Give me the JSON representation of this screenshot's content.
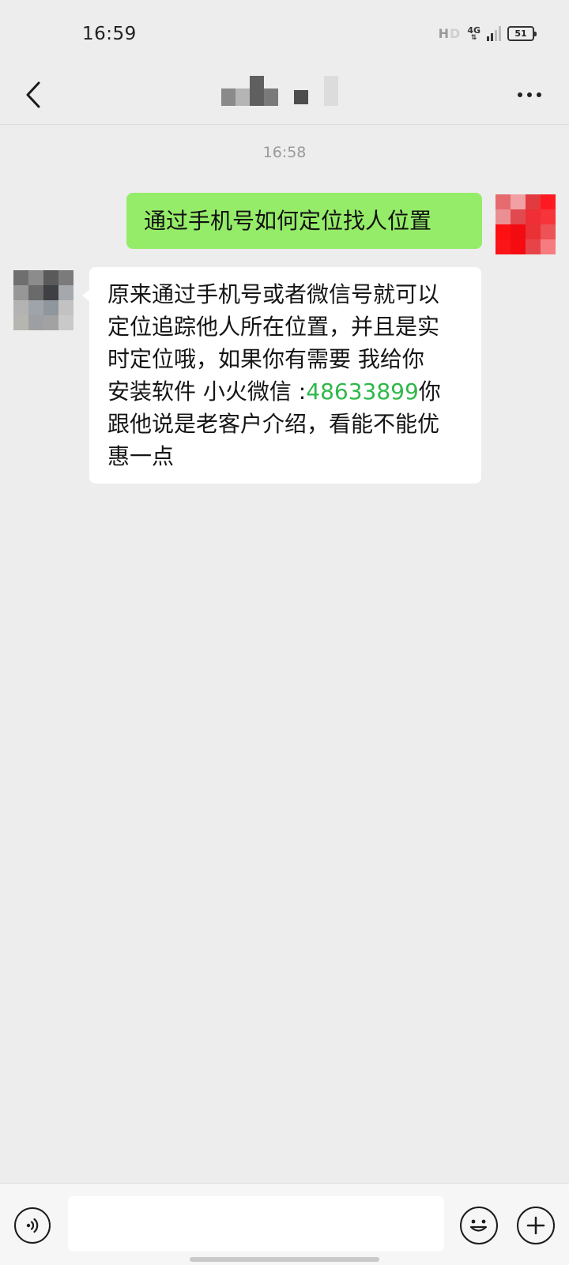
{
  "status_bar": {
    "time": "16:59",
    "hd_label": "HD",
    "network_label": "4G",
    "battery_level": "51"
  },
  "header": {
    "back_icon": "chevron-left-icon",
    "title_obscured": true,
    "more_icon": "more-dots-icon"
  },
  "chat": {
    "timestamp": "16:58",
    "messages": [
      {
        "sender": "self",
        "lines": [
          "通过手机号如何定位找人位置"
        ]
      },
      {
        "sender": "other",
        "lines": [
          "原来通过手机号或者微信号就可以",
          "定位追踪他人所在位置，并且是实",
          "时定位哦，如果你有需要 我给你"
        ],
        "line4_prefix": "安装软件 小火微信 :",
        "line4_number": "48633899",
        "line4_suffix": "你",
        "lines_after": [
          "跟他说是老客户介绍，看能不能优",
          "惠一点"
        ]
      }
    ]
  },
  "input_bar": {
    "voice_icon": "voice-icon",
    "input_value": "",
    "emoji_icon": "emoji-icon",
    "plus_icon": "plus-icon"
  },
  "colors": {
    "background": "#ededed",
    "self_bubble": "#95ec69",
    "other_bubble": "#ffffff",
    "link_number": "#2fb84a"
  }
}
